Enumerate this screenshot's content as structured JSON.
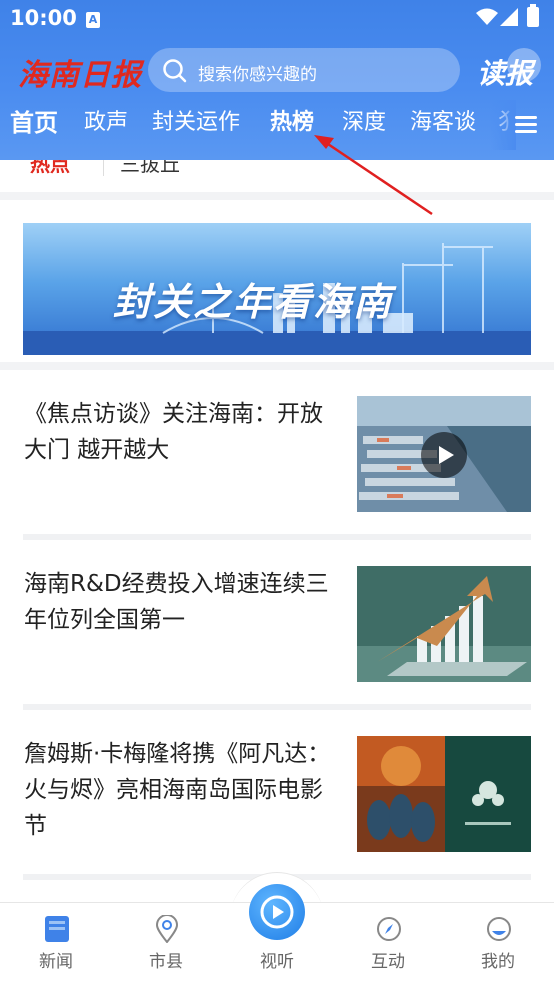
{
  "status_bar": {
    "time": "10:00",
    "badge": "A"
  },
  "header": {
    "logo_text": "海南日报",
    "search_placeholder": "搜索你感兴趣的",
    "read_paper_label": "读报"
  },
  "tabs": [
    "首页",
    "政声",
    "封关运作",
    "热榜",
    "深度",
    "海客谈",
    "犭"
  ],
  "subtabs": [
    "热点",
    "三拔丘"
  ],
  "banner": {
    "text_part1": "封关之年",
    "text_part2": "看海南"
  },
  "articles": [
    {
      "title": "《焦点访谈》关注海南：开放大门  越开越大",
      "has_video": true
    },
    {
      "title": "海南R&D经费投入增速连续三年位列全国第一",
      "has_video": false
    },
    {
      "title": "詹姆斯·卡梅隆将携《阿凡达：火与烬》亮相海南岛国际电影节",
      "has_video": false
    }
  ],
  "bottom_nav": [
    "新闻",
    "市县",
    "视听",
    "互动",
    "我的"
  ],
  "colors": {
    "brand_blue": "#3f82e8",
    "logo_red": "#e0291f",
    "annotation_arrow": "#e02020"
  }
}
